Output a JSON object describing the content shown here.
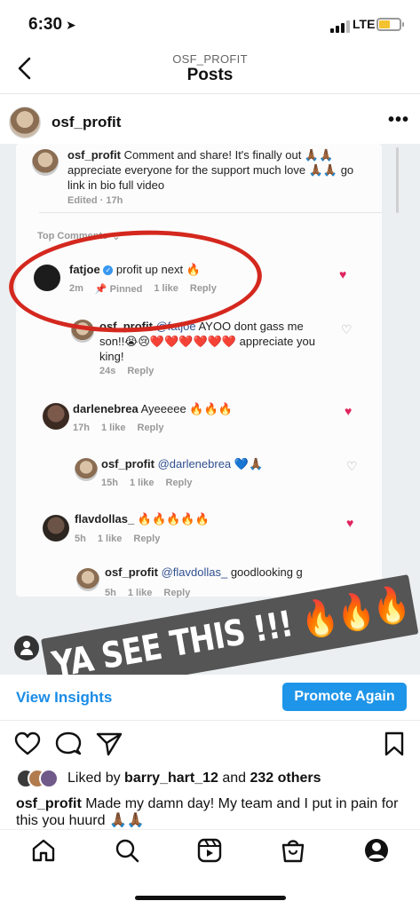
{
  "status": {
    "time": "6:30",
    "network": "LTE"
  },
  "nav": {
    "subtitle": "OSF_PROFIT",
    "title": "Posts"
  },
  "post": {
    "author": "osf_profit",
    "image": {
      "caption_comment": {
        "username": "osf_profit",
        "text": "Comment and share! It's finally out 🙏🏾🙏🏾 appreciate everyone for the support much love 🙏🏾🙏🏾 go link in bio full video",
        "meta": "Edited · 17h"
      },
      "top_comments_label": "Top Comments",
      "comments": [
        {
          "username": "fatjoe",
          "verified": true,
          "text": "profit up next 🔥",
          "time": "2m",
          "pinned": "Pinned",
          "likes": "1 like",
          "reply": "Reply",
          "liked": true
        },
        {
          "username": "osf_profit",
          "mention": "@fatjoe",
          "text": " AYOO dont gass me son!!😭😢❤️❤️❤️❤️❤️❤️ appreciate you king!",
          "time": "24s",
          "reply": "Reply",
          "liked": false
        },
        {
          "username": "darlenebrea",
          "text": "Ayeeeee 🔥🔥🔥",
          "time": "17h",
          "likes": "1 like",
          "reply": "Reply",
          "liked": true
        },
        {
          "username": "osf_profit",
          "mention": "@darlenebrea",
          "text": " 💙🙏🏾",
          "time": "15h",
          "likes": "1 like",
          "reply": "Reply",
          "liked": false
        },
        {
          "username": "flavdollas_",
          "text": "🔥🔥🔥🔥🔥",
          "time": "5h",
          "likes": "1 like",
          "reply": "Reply",
          "liked": true
        },
        {
          "username": "osf_profit",
          "mention": "@flavdollas_",
          "text": " goodlooking g",
          "time": "5h",
          "likes": "1 like",
          "reply": "Reply",
          "liked": false
        }
      ],
      "banner_text": "YA SEE THIS !!! 🔥🔥🔥"
    },
    "view_insights": "View Insights",
    "promote_again": "Promote Again",
    "liked_by_prefix": "Liked by ",
    "liked_by_user": "barry_hart_12",
    "liked_by_and": " and ",
    "liked_by_others": "232 others",
    "caption_username": "osf_profit",
    "caption_text": " Made my damn day! My team and I put in pain for this you huurd 🙏🏾🙏🏾"
  },
  "colors": {
    "accent": "#1e95e8",
    "heart": "#e0245e",
    "circle": "#d4281e"
  },
  "icons": {
    "tabs": [
      "home-icon",
      "search-icon",
      "reels-icon",
      "shop-icon",
      "profile-icon"
    ],
    "actions": [
      "like-icon",
      "comment-icon",
      "share-icon",
      "save-icon"
    ]
  }
}
